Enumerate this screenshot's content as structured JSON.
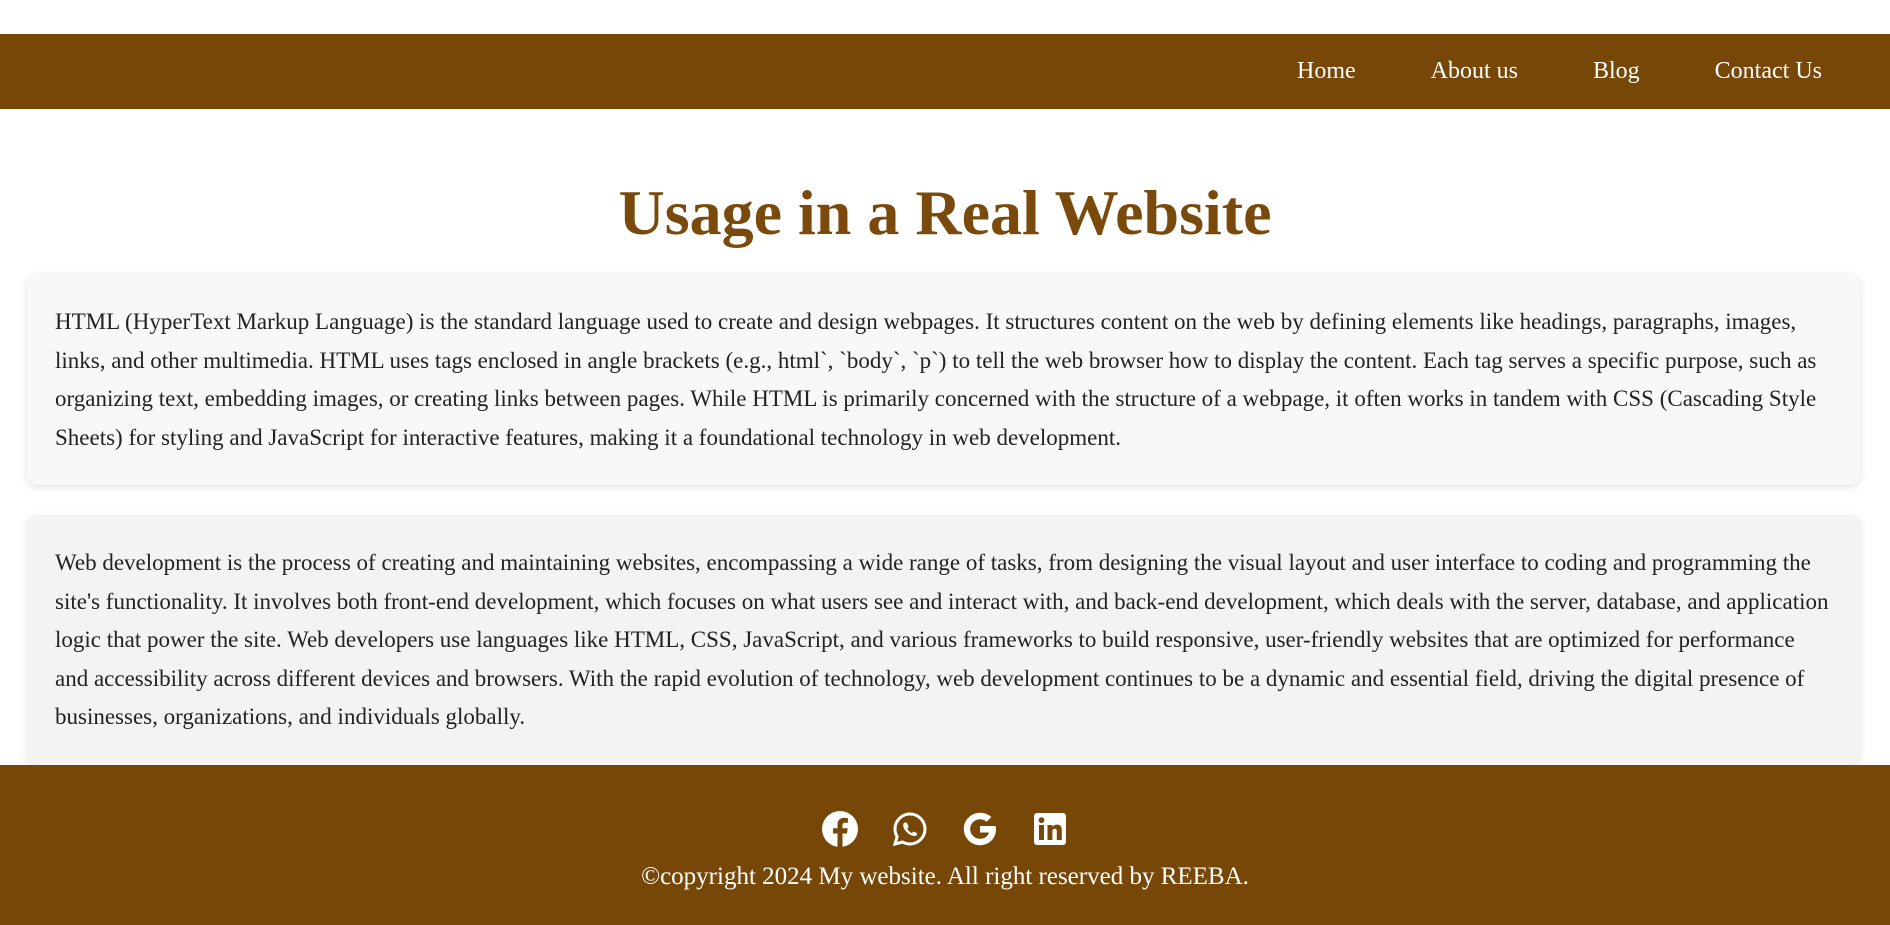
{
  "nav": {
    "items": [
      "Home",
      "About us",
      "Blog",
      "Contact Us"
    ]
  },
  "main": {
    "title": "Usage in a Real Website",
    "paragraphs": [
      "HTML (HyperText Markup Language) is the standard language used to create and design webpages. It structures content on the web by defining elements like headings, paragraphs, images, links, and other multimedia. HTML uses tags enclosed in angle brackets (e.g., html`, `body`, `p`) to tell the web browser how to display the content. Each tag serves a specific purpose, such as organizing text, embedding images, or creating links between pages. While HTML is primarily concerned with the structure of a webpage, it often works in tandem with CSS (Cascading Style Sheets) for styling and JavaScript for interactive features, making it a foundational technology in web development.",
      "Web development is the process of creating and maintaining websites, encompassing a wide range of tasks, from designing the visual layout and user interface to coding and programming the site's functionality. It involves both front-end development, which focuses on what users see and interact with, and back-end development, which deals with the server, database, and application logic that power the site. Web developers use languages like HTML, CSS, JavaScript, and various frameworks to build responsive, user-friendly websites that are optimized for performance and accessibility across different devices and browsers. With the rapid evolution of technology, web development continues to be a dynamic and essential field, driving the digital presence of businesses, organizations, and individuals globally."
    ]
  },
  "footer": {
    "social_icons": [
      "facebook-icon",
      "whatsapp-icon",
      "google-icon",
      "linkedin-icon"
    ],
    "copyright": "©copyright 2024 My website. All right reserved by REEBA."
  },
  "colors": {
    "brand_brown": "#774708",
    "title_brown": "#7a4a0c"
  }
}
